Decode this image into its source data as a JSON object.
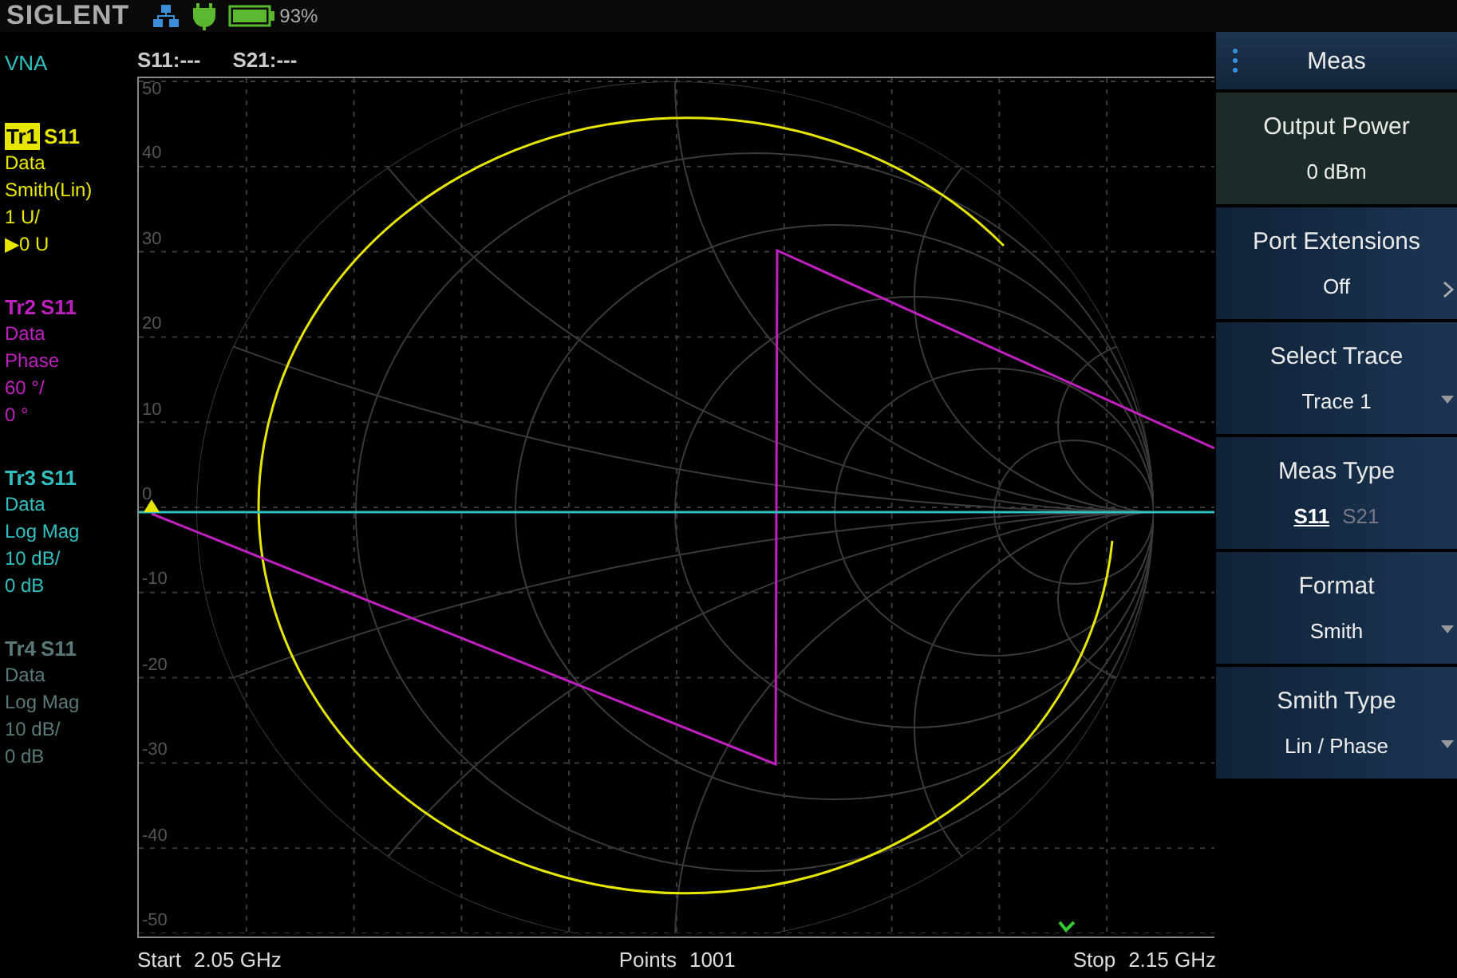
{
  "header": {
    "logo": "SIGLENT",
    "battery": "93%",
    "mode": "VNA",
    "readouts": [
      "S11:---",
      "S21:---"
    ]
  },
  "traces": [
    {
      "name": "Tr1",
      "param": "S11",
      "color": "#e6e600",
      "selected": true,
      "enabled": true,
      "lines": [
        "Data",
        "Smith(Lin)",
        "1 U/",
        "▶0 U"
      ]
    },
    {
      "name": "Tr2",
      "param": "S11",
      "color": "#c020c0",
      "selected": false,
      "enabled": true,
      "lines": [
        "Data",
        "Phase",
        "60 °/",
        "0 °"
      ]
    },
    {
      "name": "Tr3",
      "param": "S11",
      "color": "#30c0c0",
      "selected": false,
      "enabled": true,
      "lines": [
        "Data",
        "Log Mag",
        "10 dB/",
        "0 dB"
      ]
    },
    {
      "name": "Tr4",
      "param": "S11",
      "selected": false,
      "enabled": false,
      "lines": [
        "Data",
        "Log Mag",
        "10 dB/",
        "0 dB"
      ]
    }
  ],
  "plot": {
    "y_tick_labels": [
      "50",
      "40",
      "30",
      "20",
      "10",
      "0",
      "-10",
      "-20",
      "-30",
      "-40",
      "-50"
    ]
  },
  "footer": [
    {
      "label": "Start",
      "value": "2.05 GHz"
    },
    {
      "label": "Points",
      "value": "1001"
    },
    {
      "label": "Stop",
      "value": "2.15 GHz"
    }
  ],
  "menu": {
    "title": "Meas",
    "items": [
      {
        "kind": "value",
        "label": "Output Power",
        "value": "0 dBm",
        "selected": true
      },
      {
        "kind": "submenu",
        "label": "Port Extensions",
        "value": "Off",
        "selected": false
      },
      {
        "kind": "dropdown",
        "label": "Select Trace",
        "value": "Trace 1",
        "selected": false
      },
      {
        "kind": "toggle",
        "label": "Meas Type",
        "options": [
          {
            "label": "S11",
            "selected": true
          },
          {
            "label": "S21",
            "selected": false
          }
        ],
        "selected": false
      },
      {
        "kind": "dropdown",
        "label": "Format",
        "value": "Smith",
        "selected": false
      },
      {
        "kind": "dropdown",
        "label": "Smith Type",
        "value": "Lin / Phase",
        "selected": false
      }
    ]
  }
}
